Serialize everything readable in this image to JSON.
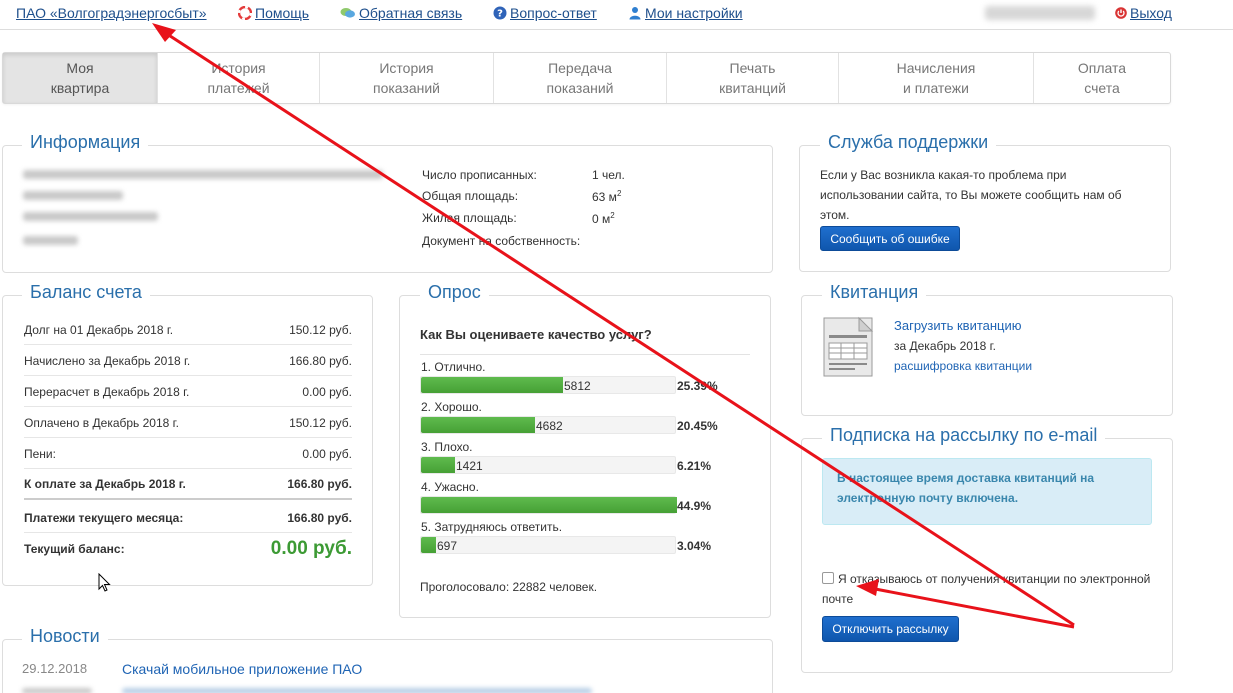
{
  "topbar": {
    "brand": "ПАО «Волгоградэнергосбыт»",
    "help": "Помощь",
    "feedback": "Обратная связь",
    "faq": "Вопрос-ответ",
    "settings": "Мои настройки",
    "logout": "Выход"
  },
  "nav": {
    "tabs": [
      {
        "label": "Моя\nквартира"
      },
      {
        "label": "История\nплатежей"
      },
      {
        "label": "История\nпоказаний"
      },
      {
        "label": "Передача\nпоказаний"
      },
      {
        "label": "Печать\nквитанций"
      },
      {
        "label": "Начисления\nи платежи"
      },
      {
        "label": "Оплата\nсчета"
      }
    ]
  },
  "info": {
    "title": "Информация",
    "registered_label": "Число прописанных:",
    "registered_value": "1 чел.",
    "total_area_label": "Общая площадь:",
    "total_area_value": "63 м",
    "living_area_label": "Жилая площадь:",
    "living_area_value": "0 м",
    "area_unit_sup": "2",
    "ownership_label": "Документ на собственность:"
  },
  "balance": {
    "title": "Баланс счета",
    "rows": [
      {
        "label": "Долг на 01 Декабрь 2018 г.",
        "value": "150.12 руб."
      },
      {
        "label": "Начислено за Декабрь 2018 г.",
        "value": "166.80 руб."
      },
      {
        "label": "Перерасчет в Декабрь 2018 г.",
        "value": "0.00 руб."
      },
      {
        "label": "Оплачено в Декабрь 2018 г.",
        "value": "150.12 руб."
      },
      {
        "label": "Пени:",
        "value": "0.00 руб."
      },
      {
        "label": "К оплате за Декабрь 2018 г.",
        "value": "166.80 руб."
      },
      {
        "label": "Платежи текущего месяца:",
        "value": "166.80 руб."
      },
      {
        "label": "Текущий баланс:",
        "value": "0.00 руб."
      }
    ]
  },
  "poll": {
    "title": "Опрос",
    "question": "Как Вы оцениваете качество услуг?",
    "options": [
      {
        "label": "1. Отлично.",
        "count": "5812",
        "pct": "25.39%",
        "fraction": 0.5539
      },
      {
        "label": "2. Хорошо.",
        "count": "4682",
        "pct": "20.45%",
        "fraction": 0.4453
      },
      {
        "label": "3. Плохо.",
        "count": "1421",
        "pct": "6.21%",
        "fraction": 0.1328
      },
      {
        "label": "4. Ужасно.",
        "count": "",
        "pct": "44.9%",
        "fraction": 1.0
      },
      {
        "label": "5. Затрудняюсь ответить.",
        "count": "697",
        "pct": "3.04%",
        "fraction": 0.0586
      }
    ],
    "total": "Проголосовало: 22882 человек."
  },
  "support": {
    "title": "Служба поддержки",
    "text": "Если у Вас возникла какая-то проблема при использовании сайта, то Вы можете сообщить нам об этом.",
    "button": "Сообщить об ошибке"
  },
  "receipt": {
    "title": "Квитанция",
    "download": "Загрузить квитанцию",
    "period": "за Декабрь 2018 г.",
    "decode": "расшифровка квитанции"
  },
  "subscription": {
    "title": "Подписка на рассылку по e-mail",
    "notice": "В настоящее время доставка квитанций на электронную почту включена.",
    "checkbox_label": "Я отказываюсь от получения квитанции по электронной почте",
    "button": "Отключить рассылку"
  },
  "news": {
    "title": "Новости",
    "items": [
      {
        "date": "29.12.2018",
        "text": "Скачай мобильное приложение ПАО"
      }
    ]
  },
  "colors": {
    "link": "#1e4f8c",
    "title": "#2a6fab",
    "bar": "#4caf3e",
    "annotation": "#e8121a",
    "balance_green": "#3c9a34"
  }
}
